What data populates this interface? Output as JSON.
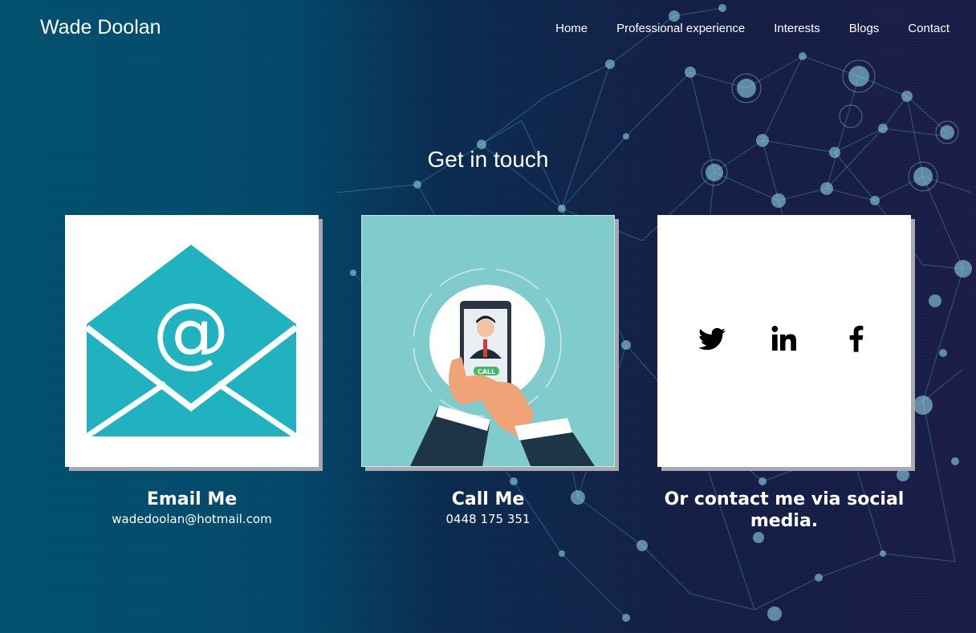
{
  "header": {
    "brand": "Wade Doolan",
    "nav": [
      "Home",
      "Professional experience",
      "Interests",
      "Blogs",
      "Contact"
    ]
  },
  "section": {
    "title": "Get in touch"
  },
  "cards": [
    {
      "heading": "Email Me",
      "detail": "wadedoolan@hotmail.com",
      "image": "envelope-icon"
    },
    {
      "heading": "Call Me",
      "detail": "0448 175 351",
      "image": "phone-call-illustration",
      "badge": "CALL"
    },
    {
      "heading": "Or contact me via social media.",
      "detail": "",
      "icons": [
        "twitter-icon",
        "linkedin-icon",
        "facebook-icon"
      ]
    }
  ],
  "colors": {
    "envelope": "#20b2bf",
    "call_card_bg": "#80cbcb",
    "call_badge": "#3ebc63"
  }
}
